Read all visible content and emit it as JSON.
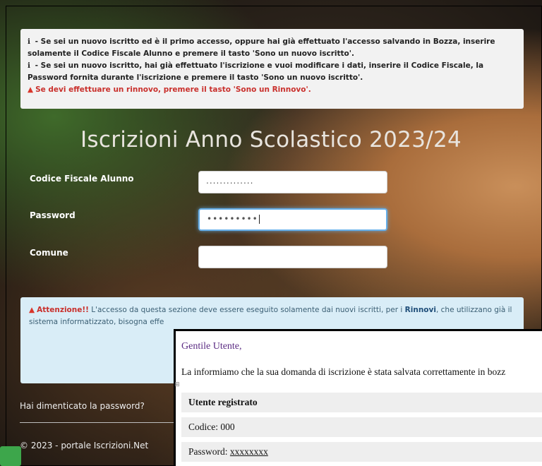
{
  "info": {
    "line1_prefix": "i",
    "line1_text": " - Se sei un nuovo iscritto ed è il primo accesso, oppure hai già effettuato l'accesso salvando in Bozza, inserire solamente il Codice Fiscale Alunno e premere il tasto 'Sono un nuovo iscritto'.",
    "line2_prefix": "i",
    "line2_text": " - Se sei un nuovo iscritto, hai già effettuato l'iscrizione e vuoi modificare i dati, inserire il Codice Fiscale, la Password fornita durante l'iscrizione e premere il tasto 'Sono un nuovo iscritto'.",
    "line3_icon": "▲",
    "line3_text": "Se devi effettuare un rinnovo, premere il tasto 'Sono un Rinnovo'."
  },
  "title": "Iscrizioni Anno Scolastico 2023/24",
  "form": {
    "codice_label": "Codice Fiscale Alunno",
    "codice_value": "..............",
    "password_label": "Password",
    "password_value": "•••••••••",
    "comune_label": "Comune",
    "comune_value": ""
  },
  "warning": {
    "icon": "▲",
    "strong": "Attenzione!!",
    "text1": " L'accesso da questa sezione deve essere eseguito solamente dai nuovi iscritti, per i ",
    "rinnovi": "Rinnovi",
    "text2": ", che utilizzano già il sistema informatizzato, bisogna effe"
  },
  "footer": {
    "forgot": "Hai dimenticato la password?",
    "copyright": "© 2023 - portale Iscrizioni.Net"
  },
  "popup": {
    "greeting": "Gentile Utente,",
    "message": "La informiamo che la sua domanda di iscrizione è stata salvata correttamente in bozz",
    "anchor": "⊞",
    "header": "Utente registrato",
    "codice": "Codice: 000",
    "password_prefix": "Password: ",
    "password_value": "xxxxxxxx"
  },
  "colors": {
    "accent_red": "#c9302c",
    "info_bg": "#d9edf7",
    "focus_blue": "#66afe9"
  }
}
